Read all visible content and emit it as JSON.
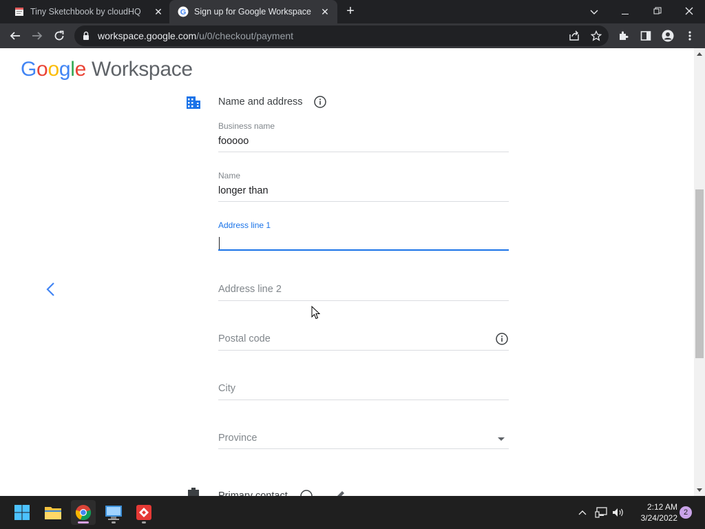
{
  "browser": {
    "tabs": [
      {
        "title": "Tiny Sketchbook by cloudHQ - C",
        "close": "✕",
        "active": false
      },
      {
        "title": "Sign up for Google Workspace",
        "close": "✕",
        "active": true
      }
    ],
    "url_host": "workspace.google.com",
    "url_path": "/u/0/checkout/payment"
  },
  "page": {
    "logo": {
      "google": [
        "G",
        "o",
        "o",
        "g",
        "l",
        "e"
      ],
      "product": "Workspace"
    },
    "section": {
      "title": "Name and address"
    },
    "fields": {
      "business_name": {
        "label": "Business name",
        "value": "fooooo"
      },
      "name": {
        "label": "Name",
        "value": "longer than"
      },
      "address_line_1": {
        "label": "Address line 1",
        "value": ""
      },
      "address_line_2": {
        "placeholder": "Address line 2"
      },
      "postal_code": {
        "placeholder": "Postal code"
      },
      "city": {
        "placeholder": "City"
      },
      "province": {
        "placeholder": "Province"
      }
    },
    "next_section": {
      "title": "Primary contact"
    }
  },
  "taskbar": {
    "clock_time": "2:12 AM",
    "clock_date": "3/24/2022",
    "notification_count": "2"
  },
  "colors": {
    "accent": "#1a73e8",
    "google_blue": "#4285f4",
    "google_red": "#ea4335",
    "google_yellow": "#fbbc05",
    "google_green": "#34a853"
  }
}
